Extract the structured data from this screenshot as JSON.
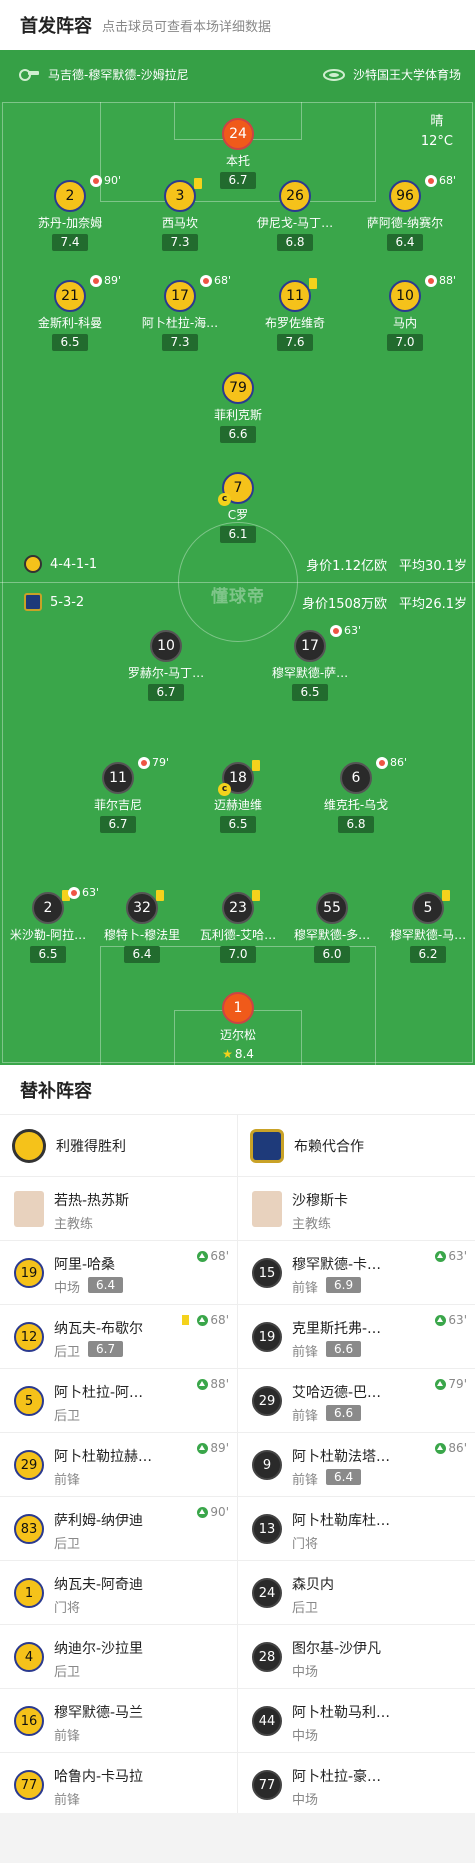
{
  "header": {
    "title": "首发阵容",
    "hint": "点击球员可查看本场详细数据"
  },
  "match": {
    "teams": "马吉德-穆罕默德-沙姆拉尼",
    "stadium": "沙特国王大学体育场",
    "weather": "晴",
    "temperature": "12°C"
  },
  "watermark": "懂球帝",
  "home_team": {
    "formation": "4-4-1-1",
    "value": "身价1.12亿欧",
    "avg_age": "平均30.1岁"
  },
  "away_team": {
    "formation": "5-3-2",
    "value": "身价1508万欧",
    "avg_age": "平均26.1岁"
  },
  "home_starters": [
    {
      "num": "24",
      "name": "本托",
      "rating": "6.7"
    },
    {
      "num": "2",
      "name": "苏丹-加奈姆",
      "rating": "7.4",
      "sub": "90'"
    },
    {
      "num": "3",
      "name": "西马坎",
      "rating": "7.3"
    },
    {
      "num": "26",
      "name": "伊尼戈-马丁…",
      "rating": "6.8"
    },
    {
      "num": "96",
      "name": "萨阿德-纳赛尔",
      "rating": "6.4",
      "sub": "68'"
    },
    {
      "num": "21",
      "name": "金斯利-科曼",
      "rating": "6.5",
      "sub": "89'"
    },
    {
      "num": "17",
      "name": "阿卜杜拉-海…",
      "rating": "7.3",
      "sub": "68'"
    },
    {
      "num": "11",
      "name": "布罗佐维奇",
      "rating": "7.6"
    },
    {
      "num": "10",
      "name": "马内",
      "rating": "7.0",
      "sub": "88'"
    },
    {
      "num": "79",
      "name": "菲利克斯",
      "rating": "6.6"
    },
    {
      "num": "7",
      "name": "C罗",
      "rating": "6.1"
    }
  ],
  "away_starters": [
    {
      "num": "10",
      "name": "罗赫尔-马丁…",
      "rating": "6.7"
    },
    {
      "num": "17",
      "name": "穆罕默德-萨…",
      "rating": "6.5",
      "sub": "63'"
    },
    {
      "num": "11",
      "name": "菲尔吉尼",
      "rating": "6.7",
      "sub": "79'"
    },
    {
      "num": "18",
      "name": "迈赫迪维",
      "rating": "6.5"
    },
    {
      "num": "6",
      "name": "维克托-乌戈",
      "rating": "6.8",
      "sub": "86'"
    },
    {
      "num": "2",
      "name": "米沙勒-阿拉…",
      "rating": "6.5",
      "sub": "63'"
    },
    {
      "num": "32",
      "name": "穆特卜-穆法里",
      "rating": "6.4"
    },
    {
      "num": "23",
      "name": "瓦利德-艾哈…",
      "rating": "7.0"
    },
    {
      "num": "55",
      "name": "穆罕默德-多…",
      "rating": "6.0"
    },
    {
      "num": "5",
      "name": "穆罕默德-马…",
      "rating": "6.2"
    },
    {
      "num": "1",
      "name": "迈尔松",
      "rating": "8.4"
    }
  ],
  "subs": {
    "title": "替补阵容",
    "home": {
      "team_name": "利雅得胜利",
      "coach": {
        "name": "若热-热苏斯",
        "role": "主教练"
      },
      "players": [
        {
          "num": "19",
          "name": "阿里-哈桑",
          "pos": "中场",
          "rating": "6.4",
          "minute": "68'"
        },
        {
          "num": "12",
          "name": "纳瓦夫-布歇尔",
          "pos": "后卫",
          "rating": "6.7",
          "minute": "68'"
        },
        {
          "num": "5",
          "name": "阿卜杜拉-阿…",
          "pos": "后卫",
          "minute": "88'"
        },
        {
          "num": "29",
          "name": "阿卜杜勒拉赫…",
          "pos": "前锋",
          "minute": "89'"
        },
        {
          "num": "83",
          "name": "萨利姆-纳伊迪",
          "pos": "后卫",
          "minute": "90'"
        },
        {
          "num": "1",
          "name": "纳瓦夫-阿奇迪",
          "pos": "门将"
        },
        {
          "num": "4",
          "name": "纳迪尔-沙拉里",
          "pos": "后卫"
        },
        {
          "num": "16",
          "name": "穆罕默德-马兰",
          "pos": "前锋"
        },
        {
          "num": "77",
          "name": "哈鲁内-卡马拉",
          "pos": "前锋"
        }
      ]
    },
    "away": {
      "team_name": "布赖代合作",
      "coach": {
        "name": "沙穆斯卡",
        "role": "主教练"
      },
      "players": [
        {
          "num": "15",
          "name": "穆罕默德-卡…",
          "pos": "前锋",
          "rating": "6.9",
          "minute": "63'"
        },
        {
          "num": "19",
          "name": "克里斯托弗-…",
          "pos": "前锋",
          "rating": "6.6",
          "minute": "63'"
        },
        {
          "num": "29",
          "name": "艾哈迈德-巴…",
          "pos": "前锋",
          "rating": "6.6",
          "minute": "79'"
        },
        {
          "num": "9",
          "name": "阿卜杜勒法塔…",
          "pos": "前锋",
          "rating": "6.4",
          "minute": "86'"
        },
        {
          "num": "13",
          "name": "阿卜杜勒库杜…",
          "pos": "门将"
        },
        {
          "num": "24",
          "name": "森贝内",
          "pos": "后卫"
        },
        {
          "num": "28",
          "name": "图尔基-沙伊凡",
          "pos": "中场"
        },
        {
          "num": "44",
          "name": "阿卜杜勒马利…",
          "pos": "中场"
        },
        {
          "num": "77",
          "name": "阿卜杜拉-豪…",
          "pos": "中场"
        }
      ]
    }
  },
  "colors": {
    "pitch": "#3aa64a",
    "home_kit": "#f5c21a",
    "away_kit": "#2a2a2a",
    "gk_kit": "#f05a1a"
  }
}
